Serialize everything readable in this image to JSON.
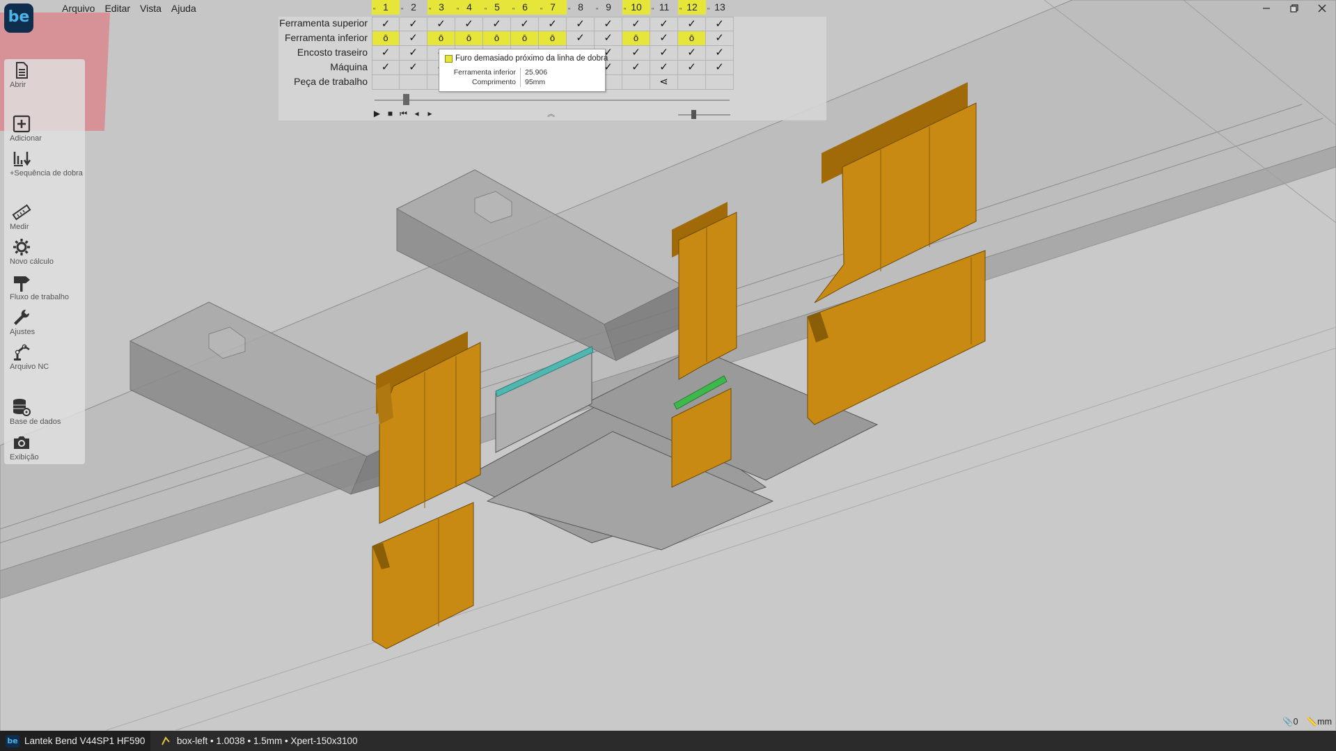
{
  "app": {
    "logo_text": "be",
    "menu": [
      "Arquivo",
      "Editar",
      "Vista",
      "Ajuda"
    ],
    "window_controls": [
      "minimize-icon",
      "maximize-icon",
      "close-icon"
    ]
  },
  "toolbar": {
    "items": [
      {
        "name": "open",
        "label": "Abrir",
        "icon": "document-icon"
      },
      {
        "name": "add",
        "label": "Adicionar",
        "icon": "plus-box-icon"
      },
      {
        "name": "bend-sequence",
        "label": "+Sequência de dobra",
        "icon": "sort-down-icon"
      },
      {
        "name": "measure",
        "label": "Medir",
        "icon": "ruler-icon"
      },
      {
        "name": "new-calc",
        "label": "Novo cálculo",
        "icon": "gear-icon"
      },
      {
        "name": "workflow",
        "label": "Fluxo de trabalho",
        "icon": "signpost-icon"
      },
      {
        "name": "settings",
        "label": "Ajustes",
        "icon": "wrench-icon"
      },
      {
        "name": "nc-file",
        "label": "Arquivo NC",
        "icon": "robot-arm-icon"
      },
      {
        "name": "database",
        "label": "Base de dados",
        "icon": "database-gear-icon"
      },
      {
        "name": "view",
        "label": "Exibição",
        "icon": "camera-icon"
      }
    ]
  },
  "sequence": {
    "columns": [
      "1",
      "2",
      "3",
      "4",
      "5",
      "6",
      "7",
      "8",
      "9",
      "10",
      "11",
      "12",
      "13"
    ],
    "highlighted_columns": [
      1,
      3,
      4,
      5,
      6,
      7,
      10,
      12
    ],
    "rows": [
      {
        "label": "Ferramenta superior",
        "cells": [
          "✓",
          "✓",
          "✓",
          "✓",
          "✓",
          "✓",
          "✓",
          "✓",
          "✓",
          "✓",
          "✓",
          "✓",
          "✓"
        ]
      },
      {
        "label": "Ferramenta inferior",
        "cells": [
          "ō",
          "✓",
          "ō",
          "ō",
          "ō",
          "ō",
          "ō",
          "✓",
          "✓",
          "ō",
          "✓",
          "ō",
          "✓"
        ]
      },
      {
        "label": "Encosto traseiro",
        "cells": [
          "✓",
          "✓",
          "✓",
          "✓",
          "✓",
          "✓",
          "✓",
          "✓",
          "✓",
          "✓",
          "✓",
          "✓",
          "✓"
        ]
      },
      {
        "label": "Máquina",
        "cells": [
          "✓",
          "✓",
          "✓",
          "✓",
          "✓",
          "✓",
          "✓",
          "✓",
          "✓",
          "✓",
          "✓",
          "✓",
          "✓"
        ]
      },
      {
        "label": "Peça de trabalho",
        "cells": [
          "",
          "",
          "",
          "",
          "",
          "",
          "",
          "",
          "",
          "",
          "⋖",
          "",
          ""
        ]
      }
    ],
    "playback": [
      "play-icon",
      "stop-icon",
      "skip-start-icon",
      "step-back-icon",
      "step-forward-icon"
    ],
    "position_fraction": 0.08,
    "zoom_fraction": 0.25
  },
  "tooltip": {
    "title": "Furo demasiado próximo da linha de dobra",
    "rows": [
      {
        "key": "Ferramenta inferior",
        "value": "25.906"
      },
      {
        "key": "Comprimento",
        "value": "95mm"
      }
    ]
  },
  "status": {
    "app_name": "Lantek Bend V44SP1 HF590",
    "document": "box-left • 1.0038 • 1.5mm • Xpert-150x3100",
    "count": "0",
    "units": "mm"
  },
  "colors": {
    "tool": "#c88a12",
    "tool_dark": "#a06a08",
    "highlight": "#e6e63a",
    "sheet": "#9a9a9a",
    "accent_green": "#3db84a",
    "accent_teal": "#4fb6b0"
  }
}
